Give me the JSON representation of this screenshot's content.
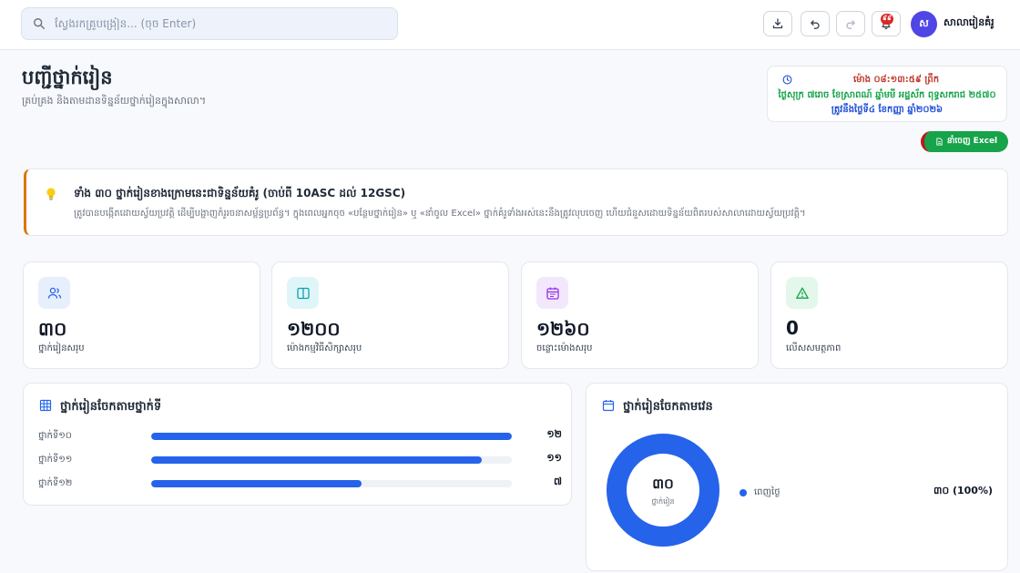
{
  "header": {
    "search_placeholder": "ស្វែងរកគ្រូបង្រៀន... (ចុច Enter)",
    "notification_count": "៩៩",
    "avatar_initial": "ស",
    "school_name": "សាលារៀនគំរូ"
  },
  "page": {
    "title": "បញ្ជីថ្នាក់រៀន",
    "subtitle": "គ្រប់គ្រង និងតាមដានទិន្នន័យថ្នាក់រៀនក្នុងសាលា។"
  },
  "clock": {
    "time": "ម៉ោង ០៨:១៣:៥៩ ព្រឹក",
    "lunar_date": "ថ្ងៃសុក្រ ៧រោច ខែស្រាពណ៍ ឆ្នាំមមី អដ្ឋស័ក ពុទ្ធសករាជ ២៥៧០",
    "solar_date": "ត្រូវនឹងថ្ងៃទី៤ ខែកញ្ញា ឆ្នាំ២០២៦"
  },
  "actions": {
    "export_excel": "នាំចេញ Excel"
  },
  "banner": {
    "title": "ទាំង ៣០ ថ្នាក់រៀនខាងក្រោមនេះជាទិន្នន័យគំរូ (ចាប់ពី 10ASC ដល់ 12GSC)",
    "text": "ត្រូវបានបង្កើតដោយស្វ័យប្រវត្តិ ដើម្បីបង្ហាញកំរូរចនាសម្ព័ន្ធប្រព័ន្ធ។ ក្នុងពេលអ្នកចុច «បន្ថែមថ្នាក់រៀន» ឬ «នាំចូល Excel» ថ្នាក់គំរូទាំងអស់នេះនឹងត្រូវលុបចេញ ហើយជំនួសដោយទិន្នន័យពិតរបស់សាលាដោយស្វ័យប្រវត្តិ។"
  },
  "stats": [
    {
      "value": "៣០",
      "label": "ថ្នាក់រៀនសរុប",
      "icon": "users-icon",
      "bg": "#e8effc",
      "fg": "#2563eb"
    },
    {
      "value": "១២០០",
      "label": "ម៉ោងកម្មវិធីសិក្សាសរុប",
      "icon": "book-icon",
      "bg": "#dff6f8",
      "fg": "#0e9fb3"
    },
    {
      "value": "១២៦០",
      "label": "ចន្លោះម៉ោងសរុប",
      "icon": "calendar-icon",
      "bg": "#f3e8fb",
      "fg": "#9333ea"
    },
    {
      "value": "0",
      "label": "លើសសមត្ថភាព",
      "icon": "warning-icon",
      "bg": "#e3f7ea",
      "fg": "#16a34a"
    }
  ],
  "grade_panel": {
    "title": "ថ្នាក់រៀនចែកតាមថ្នាក់ទី",
    "max": 12,
    "rows": [
      {
        "label": "ថ្នាក់ទី១០",
        "count": 12,
        "count_text": "១២"
      },
      {
        "label": "ថ្នាក់ទី១១",
        "count": 11,
        "count_text": "១១"
      },
      {
        "label": "ថ្នាក់ទី១២",
        "count": 7,
        "count_text": "៧"
      }
    ]
  },
  "shift_panel": {
    "title": "ថ្នាក់រៀនចែកតាមវេន",
    "total": "៣០",
    "total_label": "ថ្នាក់រៀន",
    "legend": [
      {
        "name": "ពេញថ្ងៃ",
        "value": "៣០ (100%)",
        "fraction": 1.0,
        "color": "#2563eb"
      }
    ]
  }
}
